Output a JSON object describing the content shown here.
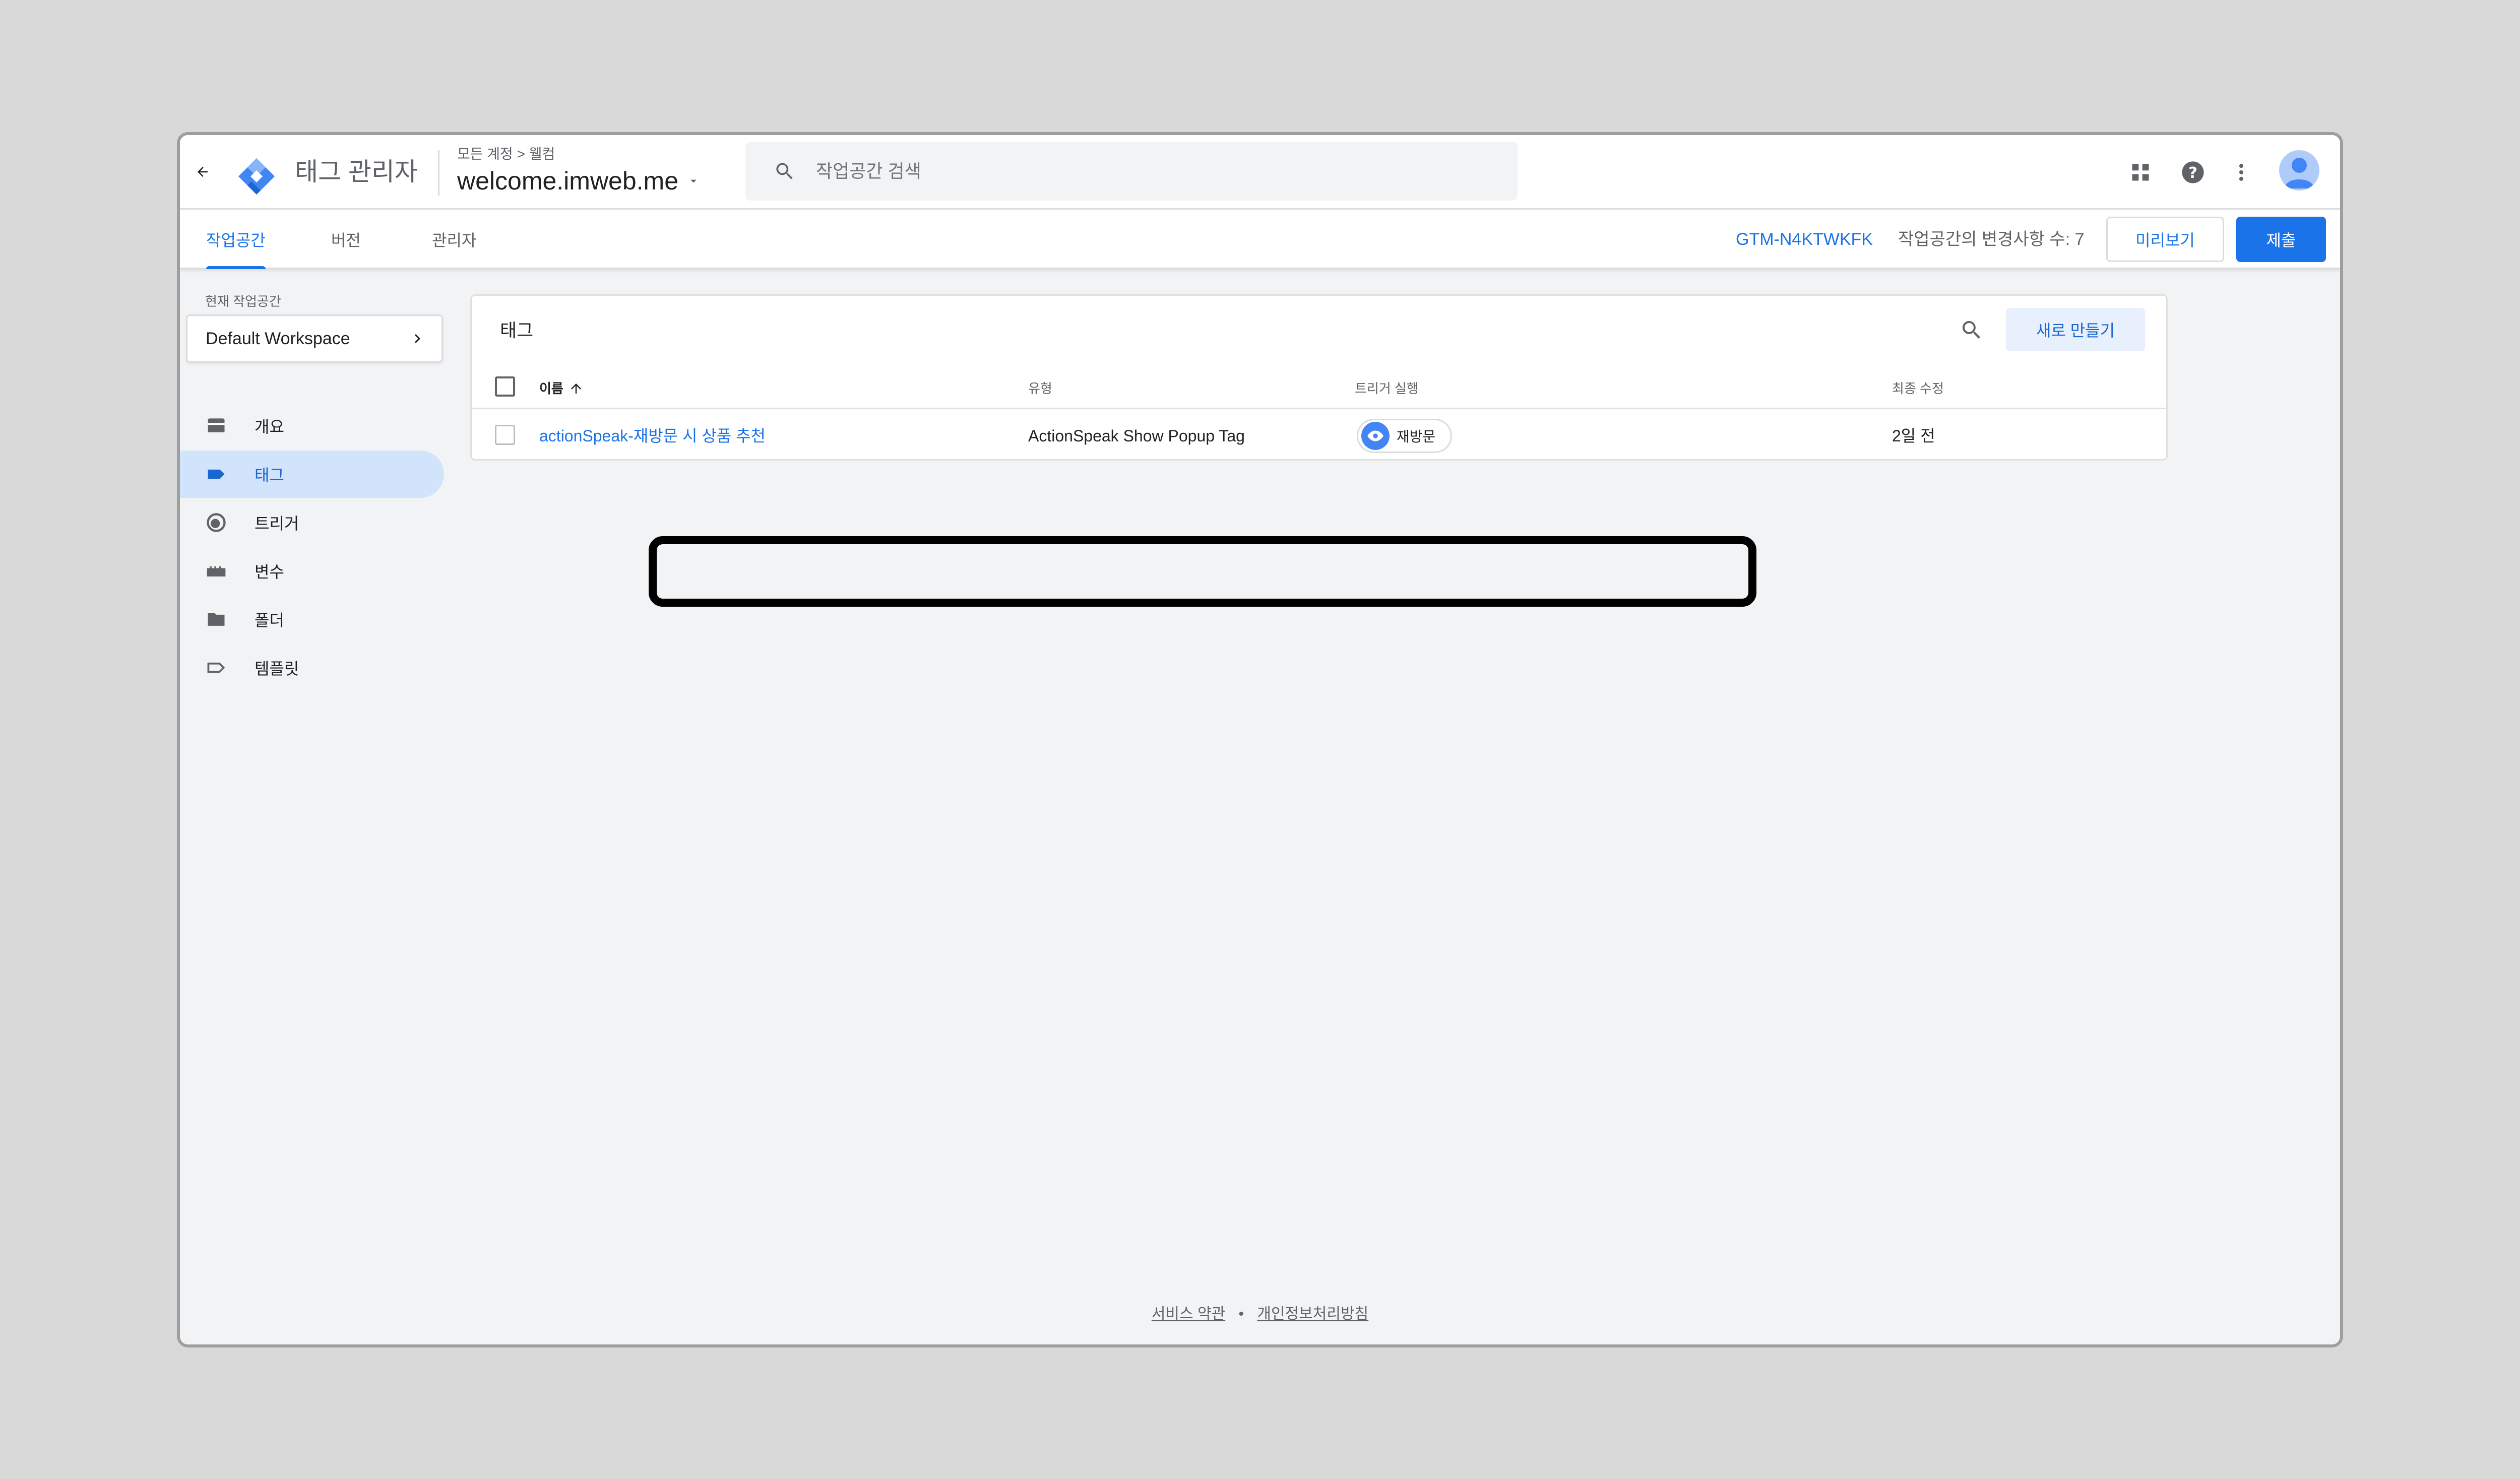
{
  "header": {
    "app_title": "태그 관리자",
    "breadcrumb": "모든 계정 > 웰컴",
    "account_name": "welcome.imweb.me",
    "search_placeholder": "작업공간 검색"
  },
  "tabs": [
    {
      "label": "작업공간",
      "active": true
    },
    {
      "label": "버전",
      "active": false
    },
    {
      "label": "관리자",
      "active": false
    }
  ],
  "toolbar": {
    "container_id": "GTM-N4KTWKFK",
    "changes_text": "작업공간의 변경사항 수: 7",
    "preview_label": "미리보기",
    "submit_label": "제출"
  },
  "sidebar": {
    "workspace_label": "현재 작업공간",
    "workspace_name": "Default Workspace",
    "items": [
      {
        "label": "개요",
        "icon": "overview-icon"
      },
      {
        "label": "태그",
        "icon": "tag-icon",
        "active": true
      },
      {
        "label": "트리거",
        "icon": "trigger-icon"
      },
      {
        "label": "변수",
        "icon": "variable-icon"
      },
      {
        "label": "폴더",
        "icon": "folder-icon"
      },
      {
        "label": "템플릿",
        "icon": "template-icon"
      }
    ]
  },
  "tags_card": {
    "title": "태그",
    "new_button": "새로 만들기",
    "columns": {
      "name": "이름",
      "type": "유형",
      "trigger": "트리거 실행",
      "modified": "최종 수정"
    },
    "rows": [
      {
        "name": "actionSpeak-재방문 시 상품 추천",
        "type": "ActionSpeak Show Popup Tag",
        "trigger": "재방문",
        "modified": "2일 전"
      }
    ]
  },
  "footer": {
    "terms": "서비스 약관",
    "separator": "•",
    "privacy": "개인정보처리방침"
  },
  "colors": {
    "accent": "#1a73e8",
    "active_nav_bg": "#d2e3fc",
    "highlight_border": "#000000"
  }
}
